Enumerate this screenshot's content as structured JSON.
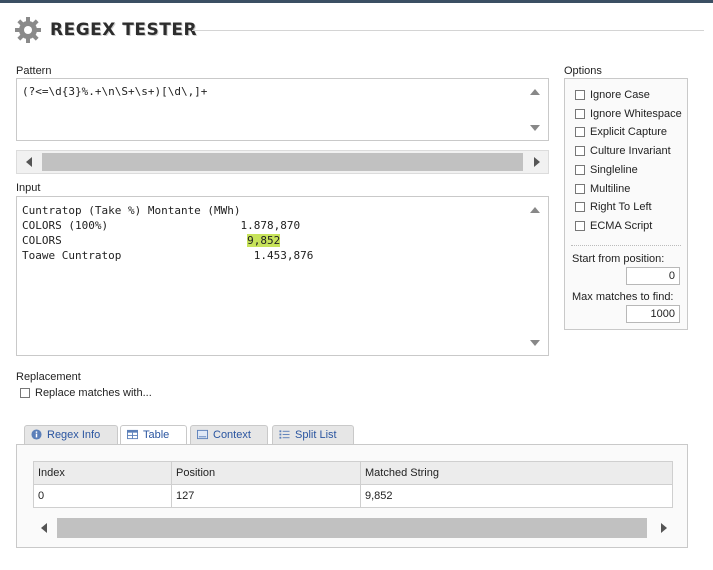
{
  "app": {
    "title": "REGEX TESTER"
  },
  "pattern": {
    "label": "Pattern",
    "value": "(?<=\\d{3}%.+\\n\\S+\\s+)[\\d\\,]+"
  },
  "input": {
    "label": "Input",
    "lines": [
      {
        "pre": "Cuntratop (Take %) Montante (MWh)",
        "match": "",
        "post": ""
      },
      {
        "pre": "COLORS (100%)                    1.878,870",
        "match": "",
        "post": ""
      },
      {
        "pre": "COLORS                            ",
        "match": "9,852",
        "post": ""
      },
      {
        "pre": "Toawe Cuntratop                    1.453,876",
        "match": "",
        "post": ""
      }
    ]
  },
  "options": {
    "title": "Options",
    "items": [
      {
        "label": "Ignore Case",
        "checked": false
      },
      {
        "label": "Ignore Whitespace",
        "checked": false
      },
      {
        "label": "Explicit Capture",
        "checked": false
      },
      {
        "label": "Culture Invariant",
        "checked": false
      },
      {
        "label": "Singleline",
        "checked": false
      },
      {
        "label": "Multiline",
        "checked": false
      },
      {
        "label": "Right To Left",
        "checked": false
      },
      {
        "label": "ECMA Script",
        "checked": false
      }
    ],
    "start_label": "Start from position:",
    "start_value": "0",
    "max_label": "Max matches to find:",
    "max_value": "1000"
  },
  "replacement": {
    "label": "Replacement",
    "checkbox_label": "Replace matches with..."
  },
  "tabs": [
    {
      "label": "Regex Info",
      "icon": "info-icon",
      "active": false
    },
    {
      "label": "Table",
      "icon": "table-icon",
      "active": true
    },
    {
      "label": "Context",
      "icon": "context-icon",
      "active": false
    },
    {
      "label": "Split List",
      "icon": "list-icon",
      "active": false
    }
  ],
  "results": {
    "columns": [
      "Index",
      "Position",
      "Matched String"
    ],
    "rows": [
      [
        "0",
        "127",
        "9,852"
      ]
    ]
  },
  "colors": {
    "match_highlight": "#c7e35a",
    "tab_text": "#2a55a0",
    "top_strip": "#3b4f63"
  }
}
